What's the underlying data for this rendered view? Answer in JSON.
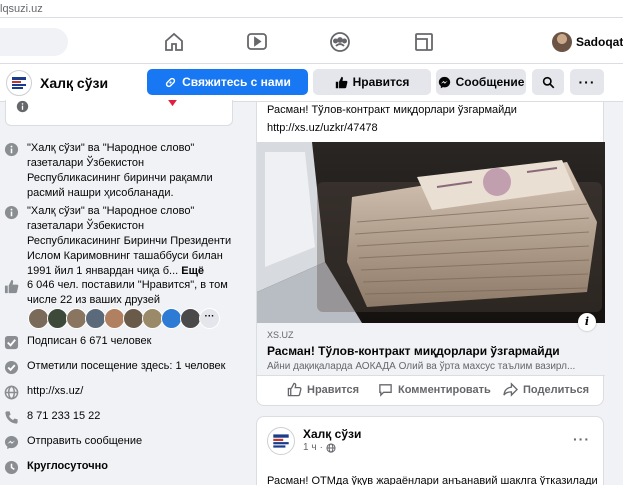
{
  "browser": {
    "url": "lqsuzi.uz"
  },
  "topnav": {
    "icons": [
      "home-icon",
      "watch-icon",
      "groups-icon",
      "gaming-icon"
    ],
    "profile_name": "Sadoqat"
  },
  "page": {
    "name": "Халқ сўзи",
    "buttons": {
      "contact": "Свяжитесь с нами",
      "like": "Нравится",
      "message": "Сообщение"
    }
  },
  "sidebar": {
    "about1": "\"Халқ сўзи\" ва \"Народное слово\" газеталари Ўзбекистон Республикасининг биринчи рақамли расмий нашри ҳисобланади.",
    "about2": "\"Халқ сўзи\" ва \"Народное слово\" газеталари Ўзбекистон Республикасининг Биринчи Президенти Ислом Каримовнинг ташаббуси билан 1991 йил 1 январдан чиқа б...",
    "about2_more": "Ещё",
    "likes": "6 046 чел. поставили \"Нравится\", в том числе 22 из ваших друзей",
    "followers": "Подписан 6 671 человек",
    "checkins": "Отметили посещение здесь: 1 человек",
    "website": "http://xs.uz/",
    "phone": "8 71 233 15 22",
    "send_message": "Отправить сообщение",
    "hours": "Круглосуточно"
  },
  "post1": {
    "text": "Расман! Тўлов-контракт миқдорлари ўзгармайди",
    "link": "http://xs.uz/uzkr/47478",
    "preview": {
      "domain": "XS.UZ",
      "title": "Расман! Тўлов-контракт миқдорлари ўзгармайди",
      "description": "Айни дақиқаларда АОКАДА Олий ва ўрта махсус таълим вазирл..."
    },
    "actions": {
      "like": "Нравится",
      "comment": "Комментировать",
      "share": "Поделиться"
    }
  },
  "post2": {
    "author": "Халқ сўзи",
    "time": "1 ч",
    "text": "Расман! ОТМда ўқув жараёнлари анъанавий шаклга ўтказилади"
  },
  "colors": {
    "primary": "#1877f2",
    "link": "#216fdb",
    "green": "#31a24c"
  }
}
